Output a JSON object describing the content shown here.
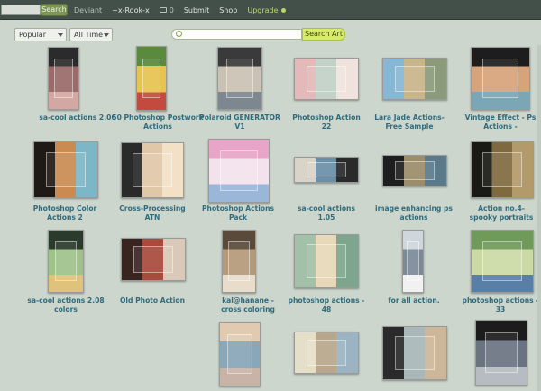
{
  "topbar": {
    "search_label": "Search",
    "nav": [
      {
        "label": "Deviant",
        "style": "muted"
      },
      {
        "label": "~x-Rook-x",
        "style": "normal"
      },
      {
        "label": "0",
        "style": "msg"
      },
      {
        "label": "Submit",
        "style": "normal"
      },
      {
        "label": "Shop",
        "style": "normal"
      },
      {
        "label": "Upgrade",
        "style": "upgrade"
      }
    ]
  },
  "filters": {
    "sort": "Popular",
    "time": "All Time"
  },
  "search": {
    "placeholder": "",
    "button_label": "Search Art"
  },
  "gallery": [
    {
      "title": "sa-cool actions 2.06",
      "colors": [
        "#2b2b2b",
        "#9b6a6a",
        "#d4a8a2"
      ]
    },
    {
      "title": "50 Photoshop Postwork Actions",
      "colors": [
        "#5a8a3d",
        "#e7c34f",
        "#c24a3f"
      ]
    },
    {
      "title": "Polaroid GENERATOR V1",
      "colors": [
        "#3a3a3a",
        "#c9c2b4",
        "#7d8790"
      ]
    },
    {
      "title": "Photoshop Action 22",
      "colors": [
        "#e5b9b9",
        "#c3d1c7",
        "#f0e3dd"
      ]
    },
    {
      "title": "Lara Jade Actions- Free Sample",
      "colors": [
        "#86b7d4",
        "#c9b58a",
        "#8a9a7a"
      ]
    },
    {
      "title": "Vintage Effect - Ps Actions -",
      "colors": [
        "#1d1d1d",
        "#d6a37a",
        "#7aa6b5"
      ]
    },
    {
      "title": "Photoshop Color Actions 2",
      "colors": [
        "#1f1a15",
        "#c98b52",
        "#7db7c7"
      ]
    },
    {
      "title": "Cross-Processing ATN",
      "colors": [
        "#2a2a2a",
        "#e0c7a8",
        "#f2e1c7"
      ]
    },
    {
      "title": "Photoshop Actions Pack",
      "colors": [
        "#e8a5c7",
        "#f3e2ec",
        "#9ab7d9"
      ]
    },
    {
      "title": "sa-cool actions 1.05",
      "colors": [
        "#d9d3c8",
        "#6b8fa6",
        "#2a2a2a"
      ]
    },
    {
      "title": "image enhancing ps actions",
      "colors": [
        "#1e1e1e",
        "#9b8d6a",
        "#5a7a8a"
      ]
    },
    {
      "title": "Action no.4-spooky portraits",
      "colors": [
        "#1a1a14",
        "#7f6a3f",
        "#b39a6a"
      ]
    },
    {
      "title": "sa-cool actions 2.08 colors",
      "colors": [
        "#2a3a2c",
        "#9fc28a",
        "#e0c37a"
      ]
    },
    {
      "title": "Old Photo Action",
      "colors": [
        "#3a2420",
        "#a84a3c",
        "#d8c9b9"
      ]
    },
    {
      "title": "kal@hanane - cross coloring",
      "colors": [
        "#5a4a3a",
        "#b59a7a",
        "#e8dccb"
      ]
    },
    {
      "title": "photoshop actions - 48",
      "colors": [
        "#a3c0a8",
        "#e6d8b9",
        "#7ea58e"
      ]
    },
    {
      "title": "for all action.",
      "colors": [
        "#cfd7dd",
        "#7b8a99",
        "#f1f1f1"
      ]
    },
    {
      "title": "photoshop actions - 33",
      "colors": [
        "#6f9a5a",
        "#cbd9a5",
        "#5a7fa6"
      ]
    },
    {
      "title": "",
      "colors": [
        "#e1cbb0",
        "#88a7b8",
        "#c9b3a6"
      ]
    },
    {
      "title": "",
      "colors": [
        "#e6dfc7",
        "#b8a78a",
        "#9cb3c2"
      ]
    },
    {
      "title": "",
      "colors": [
        "#2a2a2a",
        "#a9b7b9",
        "#cdb79a"
      ]
    },
    {
      "title": "",
      "colors": [
        "#1c1c1c",
        "#6a7480",
        "#b7bcc2"
      ]
    }
  ]
}
